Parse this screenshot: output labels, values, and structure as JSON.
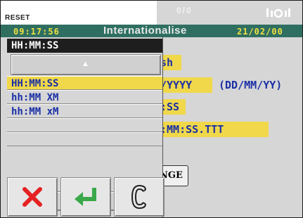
{
  "topbar": {
    "reset_label": "RESET",
    "counter": "0/0",
    "signal_icon": "signal-strength-icon"
  },
  "status": {
    "time": "09:17:56",
    "title": "Internationalise",
    "date": "21/02/00"
  },
  "background_form": {
    "language_value_fragment": "sh",
    "date_format_value_fragment": "/YYYY",
    "date_format_hint": "(DD/MM/YY)",
    "time_format_value_fragment": ":SS",
    "timestamp_value_fragment": ":MM:SS.TTT",
    "button_fragment": "NGE"
  },
  "dropdown": {
    "current_value": "HH:MM:SS",
    "options": [
      "HH:MM:SS",
      "hh:MM XM",
      "hh:MM xM",
      "",
      ""
    ],
    "selected_index": 0
  },
  "actions": {
    "cancel_icon": "cross-icon",
    "confirm_icon": "enter-arrow-icon",
    "clear_icon": "clear-c-icon"
  },
  "colors": {
    "status_bar": "#2f6f62",
    "status_text": "#f0e040",
    "field_bg": "#f0d84a",
    "field_text": "#1a2fa6",
    "cancel_red": "#e52222",
    "confirm_green": "#3aa84a"
  }
}
